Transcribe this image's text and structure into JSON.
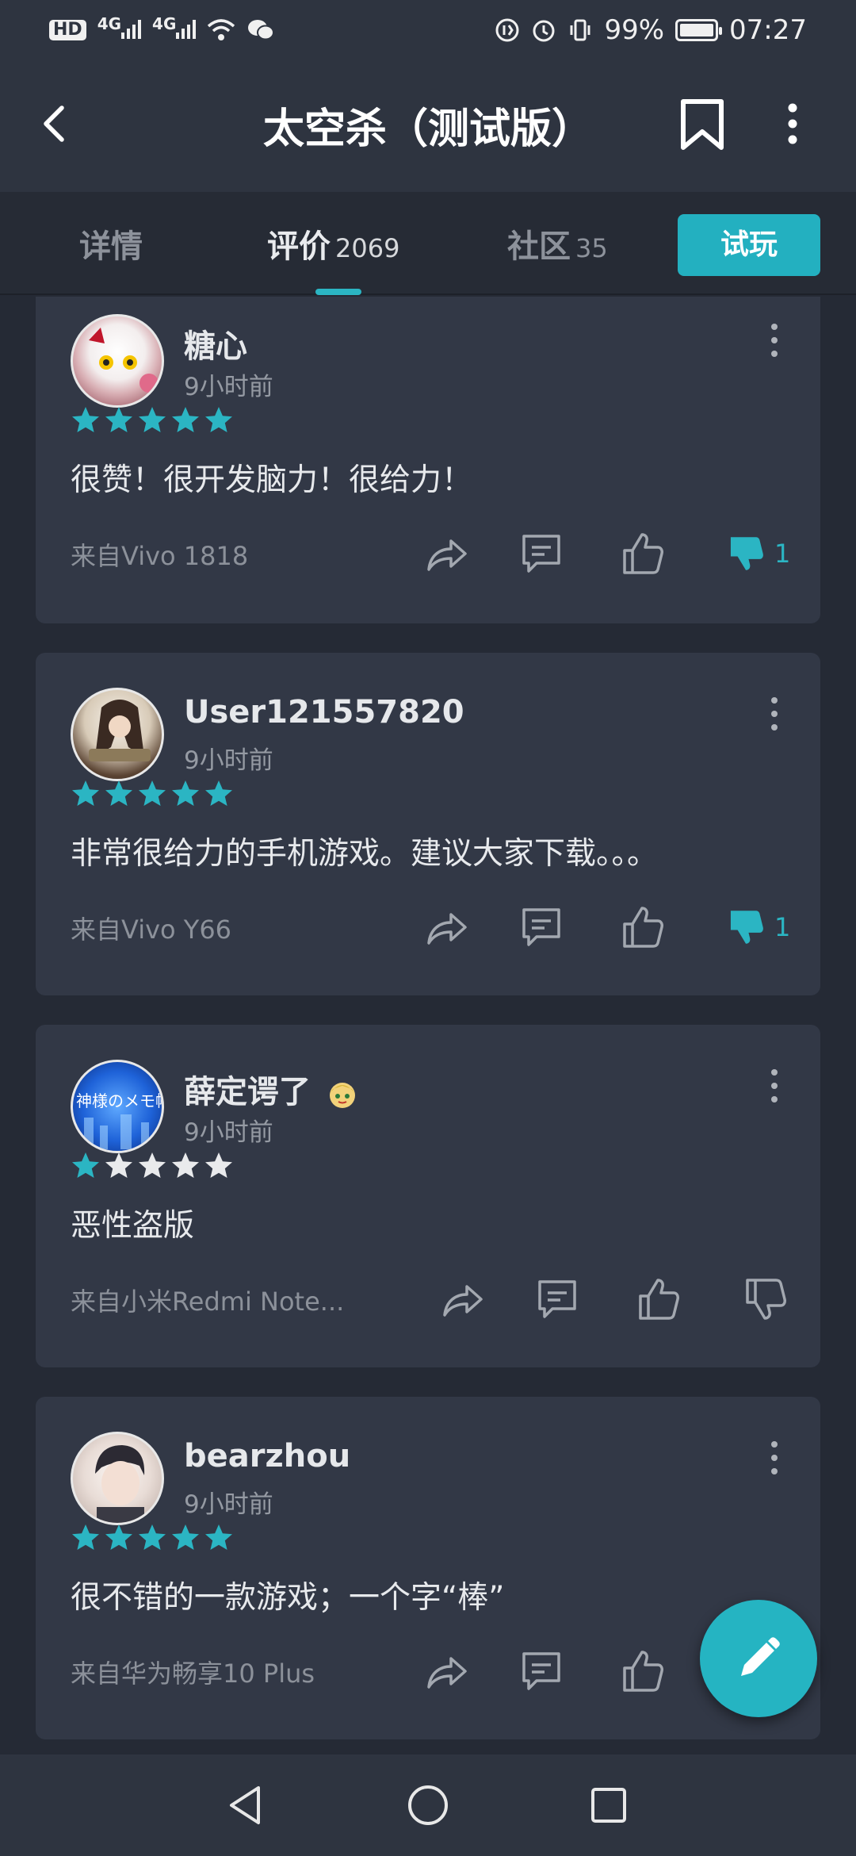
{
  "status_bar": {
    "hd": "HD",
    "network1": "4G",
    "network2": "4G",
    "battery_percent": "99%",
    "battery_level": 0.99,
    "time": "07:27"
  },
  "header": {
    "title": "太空杀（测试版）"
  },
  "tabs": [
    {
      "label": "详情",
      "count": ""
    },
    {
      "label": "评价",
      "count": "2069"
    },
    {
      "label": "社区",
      "count": "35"
    }
  ],
  "try_button": "试玩",
  "reviews": [
    {
      "name": "糖心",
      "time": "9小时前",
      "rating": 5,
      "text": "很赞！很开发脑力！很给力！",
      "device": "来自Vivo 1818",
      "dislike_count": "1"
    },
    {
      "name": "User121557820",
      "time": "9小时前",
      "rating": 5,
      "text": "非常很给力的手机游戏。建议大家下载。。。",
      "device": "来自Vivo Y66",
      "dislike_count": "1"
    },
    {
      "name": "薛定谔了",
      "time": "9小时前",
      "rating": 1,
      "text": "恶性盗版",
      "device": "来自小米Redmi Note...",
      "dislike_count": ""
    },
    {
      "name": "bearzhou",
      "time": "9小时前",
      "rating": 5,
      "text": "很不错的一款游戏；一个字“棒”",
      "device": "来自华为畅享10 Plus",
      "dislike_count": ""
    }
  ],
  "colors": {
    "accent": "#2bb5c3",
    "background": "#252a35",
    "card": "#323846",
    "star_empty": "#e9eaec"
  }
}
